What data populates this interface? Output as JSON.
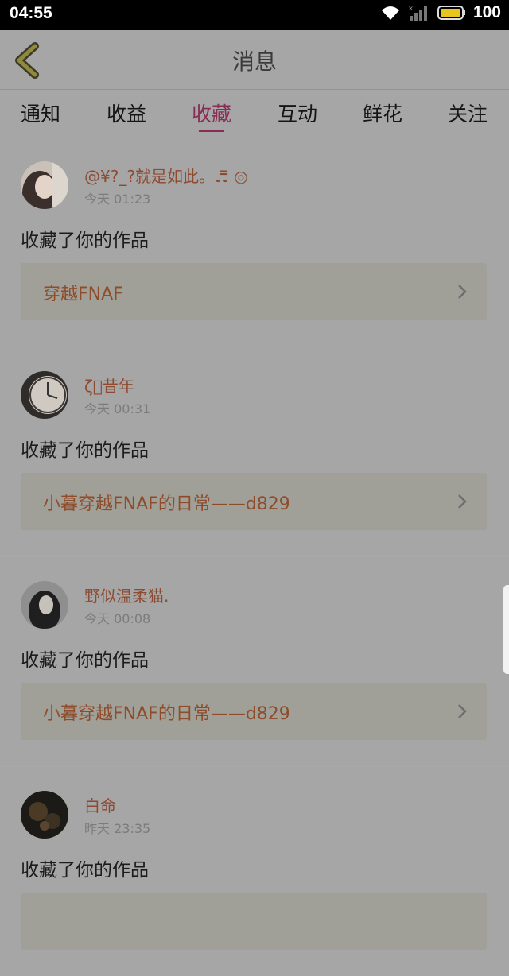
{
  "status_bar": {
    "time": "04:55",
    "battery": "100"
  },
  "header": {
    "title": "消息"
  },
  "tabs": [
    {
      "label": "通知"
    },
    {
      "label": "收益"
    },
    {
      "label": "收藏",
      "active": true
    },
    {
      "label": "互动"
    },
    {
      "label": "鲜花"
    },
    {
      "label": "关注"
    }
  ],
  "messages": [
    {
      "username": "@¥?_?就是如此。♬ ◎",
      "time": "今天 01:23",
      "action": "收藏了你的作品",
      "work_title": "穿越FNAF"
    },
    {
      "username": "ζ゚昔年",
      "time": "今天 00:31",
      "action": "收藏了你的作品",
      "work_title": "小暮穿越FNAF的日常——d829"
    },
    {
      "username": "野似温柔猫.",
      "time": "今天 00:08",
      "action": "收藏了你的作品",
      "work_title": "小暮穿越FNAF的日常——d829"
    },
    {
      "username": "白命",
      "time": "昨天 23:35",
      "action": "收藏了你的作品",
      "work_title": ""
    }
  ],
  "colors": {
    "accent": "#8a2d55",
    "link_text": "#8e4c2a",
    "overlay_bg": "#a6a6a6"
  }
}
